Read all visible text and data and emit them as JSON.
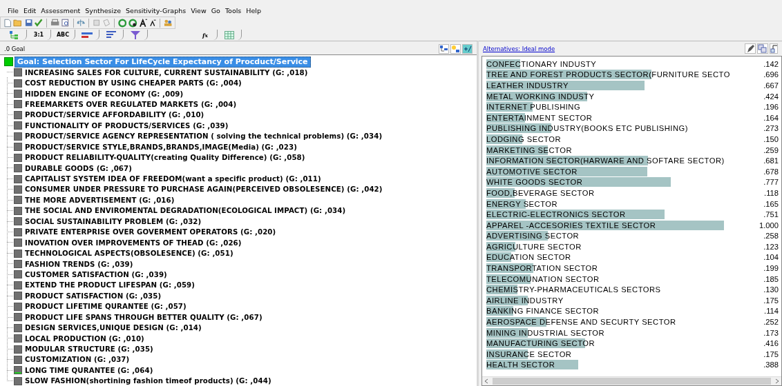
{
  "menu": [
    "File",
    "Edit",
    "Assessment",
    "Synthesize",
    "Sensitivity-Graphs",
    "View",
    "Go",
    "Tools",
    "Help"
  ],
  "toolbar_tabs": [
    {
      "kind": "tree"
    },
    {
      "kind": "text",
      "label": "3:1"
    },
    {
      "kind": "text",
      "label": "ABC"
    },
    {
      "kind": "bars"
    },
    {
      "kind": "lines"
    },
    {
      "kind": "funnel"
    },
    {
      "kind": "formula",
      "label": "fx"
    },
    {
      "kind": "grid"
    }
  ],
  "tree_header": {
    "title": ".0 Goal"
  },
  "goal": {
    "label": "Goal: Selection Sector  For LifeCycle Expectancy of Procduct/Service",
    "selected": true
  },
  "criteria": [
    {
      "label": "INCREASING SALES  FOR CULTURE, CURRENT SUSTAINABILITY (G: ,018)",
      "marked": false
    },
    {
      "label": "COST REDUCTION  BY USING CHEAPER PARTS (G: ,004)",
      "marked": false
    },
    {
      "label": "HIDDEN ENGINE OF ECONOMY (G: ,009)",
      "marked": false
    },
    {
      "label": "FREEMARKETS OVER REGULATED MARKETS (G: ,004)",
      "marked": false
    },
    {
      "label": "PRODUCT/SERVICE AFFORDABILITY (G: ,010)",
      "marked": false
    },
    {
      "label": "FUNCTIONALITY OF PRODUCTS/SERVICES (G: ,039)",
      "marked": false
    },
    {
      "label": "PRODUCT/SERVICE AGENCY REPRESENTATION ( solving the technical problems) (G: ,034)",
      "marked": false
    },
    {
      "label": "PRODUCT/SERVICE STYLE,BRANDS,BRANDS,IMAGE(Media) (G: ,023)",
      "marked": false
    },
    {
      "label": "PRODUCT RELIABILITY-QUALITY(creating Quality Difference) (G: ,058)",
      "marked": false
    },
    {
      "label": "DURABLE GOODS (G: ,067)",
      "marked": false
    },
    {
      "label": "CAPITALIST SYSTEM IDEA OF FREEDOM(want a specific product) (G: ,011)",
      "marked": false
    },
    {
      "label": "CONSUMER UNDER PRESSURE TO PURCHASE AGAIN(PERCEIVED OBSOLESENCE) (G: ,042)",
      "marked": false
    },
    {
      "label": "THE MORE ADVERTISEMENT (G: ,016)",
      "marked": false
    },
    {
      "label": "THE SOCIAL AND ENVIROMENTAL DEGRADATION(ECOLOGICAL IMPACT) (G: ,034)",
      "marked": false
    },
    {
      "label": "SOCIAL SUSTAINABILITY PROBLEM (G: ,032)",
      "marked": false
    },
    {
      "label": "PRIVATE ENTERPRISE OVER GOVERMENT OPERATORS (G: ,020)",
      "marked": false
    },
    {
      "label": "INOVATION OVER IMPROVEMENTS OF THEAD (G: ,026)",
      "marked": false
    },
    {
      "label": "TECHNOLOGICAL ASPECTS(OBSOLESENCE) (G: ,051)",
      "marked": false
    },
    {
      "label": "FASHION TRENDS (G: ,039)",
      "marked": false
    },
    {
      "label": "CUSTOMER SATISFACTION (G: ,039)",
      "marked": false
    },
    {
      "label": "EXTEND THE PRODUCT LIFESPAN (G: ,059)",
      "marked": false
    },
    {
      "label": "PRODUCT SATISFACTION (G: ,035)",
      "marked": false
    },
    {
      "label": "PRODUCT LIFETIME QURANTEE (G: ,057)",
      "marked": false
    },
    {
      "label": "PRODUCT LIFE SPANS THROUGH BETTER QUALITY (G: ,067)",
      "marked": false
    },
    {
      "label": "DESIGN SERVICES,UNIQUE DESIGN (G: ,014)",
      "marked": false
    },
    {
      "label": "LOCAL PRODUCTION (G: ,010)",
      "marked": false
    },
    {
      "label": "MODULAR STRUCTURE (G: ,035)",
      "marked": false
    },
    {
      "label": "CUSTOMIZATION (G: ,037)",
      "marked": false
    },
    {
      "label": "LONG TIME QURANTEE (G: ,064)",
      "marked": true
    },
    {
      "label": "SLOW FASHION(shortining fashion timeof products) (G: ,044)",
      "marked": false
    }
  ],
  "alternatives_header": {
    "link": "Alternatives: Ideal mode"
  },
  "alternatives": [
    {
      "name": "CONFECTIONARY  INDUSTY",
      "value": ".142",
      "level": 0.142
    },
    {
      "name": "TREE AND FOREST PRODUCTS SECTOR(FURNITURE SECTO",
      "value": ".696",
      "level": 0.696
    },
    {
      "name": "LEATHER INDUSTRY",
      "value": ".667",
      "level": 0.667
    },
    {
      "name": "METAL WORKING INDUSTY",
      "value": ".424",
      "level": 0.424
    },
    {
      "name": "INTERNET PUBLISHING",
      "value": ".196",
      "level": 0.196
    },
    {
      "name": "ENTERTAINMENT  SECTOR",
      "value": ".164",
      "level": 0.164
    },
    {
      "name": "PUBLISHING INDUSTRY(BOOKS ETC PUBLISHING)",
      "value": ".273",
      "level": 0.273
    },
    {
      "name": "LODGING SECTOR",
      "value": ".150",
      "level": 0.15
    },
    {
      "name": "MARKETING SECTOR",
      "value": ".259",
      "level": 0.259
    },
    {
      "name": "INFORMATION SECTOR(HARWARE AND SOFTARE SECTOR)",
      "value": ".681",
      "level": 0.681
    },
    {
      "name": "AUTOMOTIVE SECTOR",
      "value": ".678",
      "level": 0.678
    },
    {
      "name": "WHITE GOODS SECTOR",
      "value": ".777",
      "level": 0.777
    },
    {
      "name": "FOOD,BEVERAGE  SECTOR",
      "value": ".118",
      "level": 0.118
    },
    {
      "name": "ENERGY SECTOR",
      "value": ".165",
      "level": 0.165
    },
    {
      "name": "ELECTRIC-ELECTRONICS SECTOR",
      "value": ".751",
      "level": 0.751
    },
    {
      "name": "APPAREL -ACCESORIES TEXTILE SECTOR",
      "value": "1.000",
      "level": 1.0
    },
    {
      "name": "ADVERTISING SECTOR",
      "value": ".258",
      "level": 0.258
    },
    {
      "name": "AGRICULTURE SECTOR",
      "value": ".123",
      "level": 0.123
    },
    {
      "name": "EDUCATION SECTOR",
      "value": ".104",
      "level": 0.104
    },
    {
      "name": "TRANSPORTATION SECTOR",
      "value": ".199",
      "level": 0.199
    },
    {
      "name": "TELECOMUNATION SECTOR",
      "value": ".185",
      "level": 0.185
    },
    {
      "name": "CHEMISTRY-PHARMACEUTICALS SECTORS",
      "value": ".130",
      "level": 0.13
    },
    {
      "name": "AIRLINE INDUSTRY",
      "value": ".175",
      "level": 0.175
    },
    {
      "name": "BANKING FINANCE SECTOR",
      "value": ".114",
      "level": 0.114
    },
    {
      "name": "AEROSPACE DEFENSE AND SECURTY SECTOR",
      "value": ".252",
      "level": 0.252
    },
    {
      "name": "MINING INDUSTRIAL SECTOR",
      "value": ".173",
      "level": 0.173
    },
    {
      "name": "MANUFACTURING SECTOR",
      "value": ".416",
      "level": 0.416
    },
    {
      "name": "INSURANCE SECTOR",
      "value": ".175",
      "level": 0.175
    },
    {
      "name": "HEALTH SECTOR",
      "value": ".388",
      "level": 0.388
    }
  ]
}
